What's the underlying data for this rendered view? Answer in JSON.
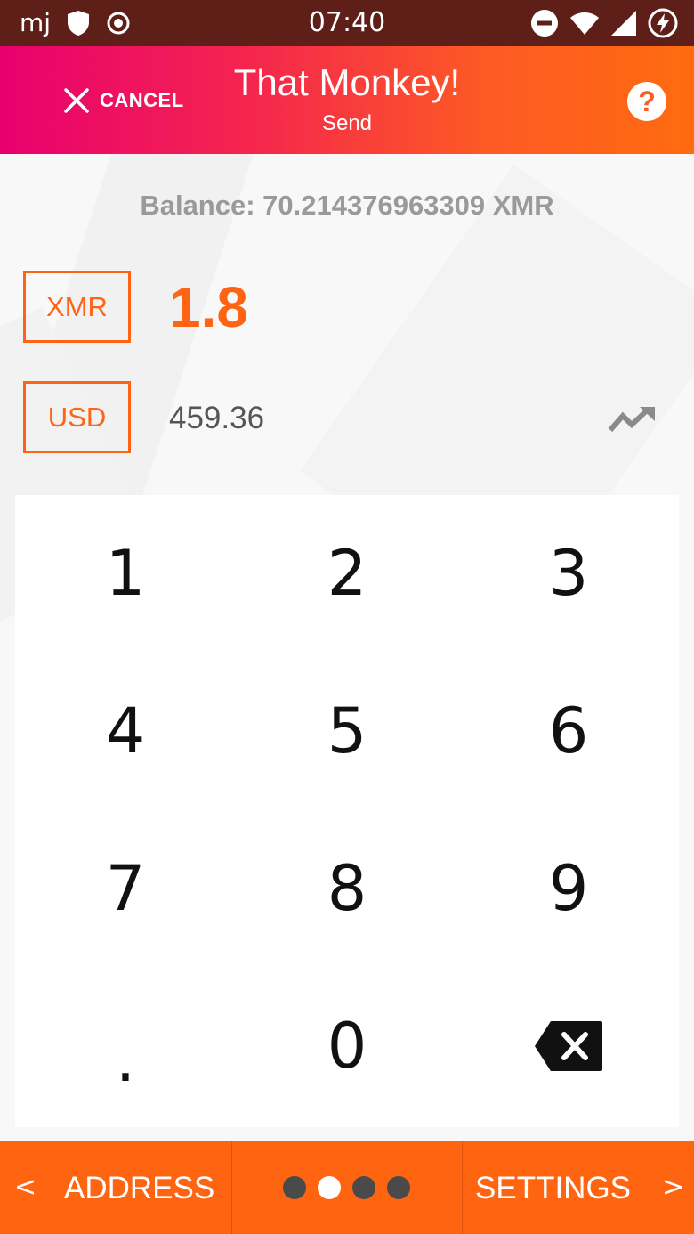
{
  "status_bar": {
    "app_glyph": "mj",
    "time": "07:40",
    "icons": [
      "shield-icon",
      "record-icon",
      "do-not-disturb-icon",
      "wifi-icon",
      "signal-icon",
      "battery-charging-icon"
    ]
  },
  "header": {
    "cancel_label": "CANCEL",
    "title": "That Monkey!",
    "subtitle": "Send",
    "help_label": "?"
  },
  "balance": "Balance: 70.214376963309 XMR",
  "amounts": {
    "primary_currency": "XMR",
    "primary_value": "1.8",
    "secondary_currency": "USD",
    "secondary_value": "459.36"
  },
  "keypad": {
    "keys": [
      "1",
      "2",
      "3",
      "4",
      "5",
      "6",
      "7",
      "8",
      "9",
      ".",
      "0"
    ]
  },
  "footer": {
    "prev_label": "ADDRESS",
    "next_label": "SETTINGS",
    "prev_chevron": "<",
    "next_chevron": ">",
    "step_current": 2,
    "step_total": 4
  },
  "colors": {
    "accent": "#ff6414",
    "status_bar": "#5e1f18",
    "header_gradient_start": "#e8006f",
    "header_gradient_end": "#ff6b10"
  }
}
